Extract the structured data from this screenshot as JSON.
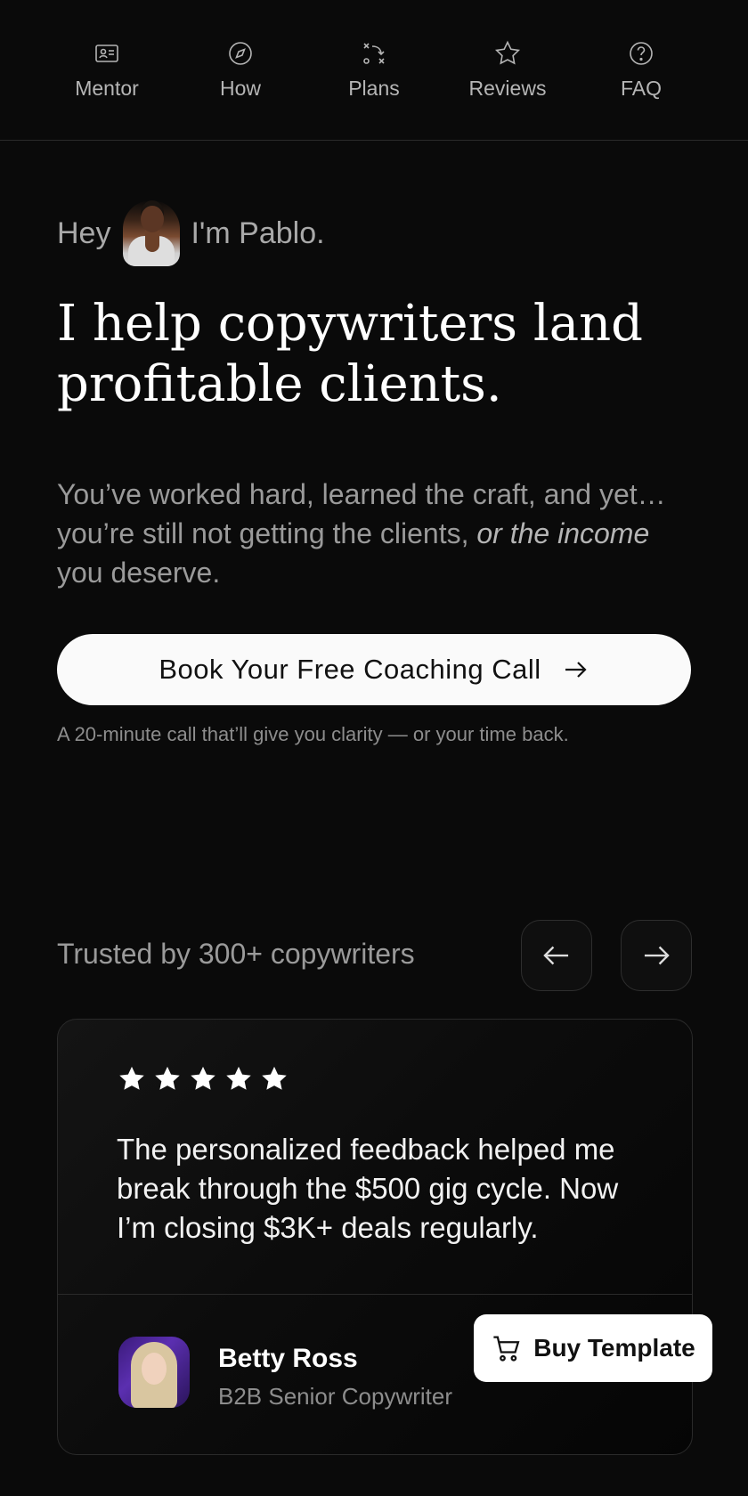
{
  "nav": {
    "items": [
      {
        "label": "Mentor",
        "icon": "id-card-icon"
      },
      {
        "label": "How",
        "icon": "compass-icon"
      },
      {
        "label": "Plans",
        "icon": "strategy-icon"
      },
      {
        "label": "Reviews",
        "icon": "star-icon"
      },
      {
        "label": "FAQ",
        "icon": "question-circle-icon"
      }
    ]
  },
  "hero": {
    "greeting_before": "Hey",
    "greeting_after": "I'm Pablo.",
    "headline": "I help copywriters land profitable clients.",
    "subcopy_plain": "You’ve worked hard, learned the craft, and yet… you’re still not getting the clients,",
    "subcopy_italic": "or the income",
    "subcopy_end": "you deserve.",
    "cta_label": "Book Your Free Coaching Call",
    "cta_note": "A 20-minute call that’ll give you clarity — or your time back."
  },
  "testimonials": {
    "heading": "Trusted by 300+ copywriters",
    "rating": 5,
    "quote": "The personalized feedback helped me break through the $500 gig cycle. Now I’m closing $3K+ deals regularly.",
    "reviewer_name": "Betty Ross",
    "reviewer_role": "B2B Senior Copywriter"
  },
  "buy_button": {
    "label": "Buy Template",
    "icon": "cart-icon"
  }
}
